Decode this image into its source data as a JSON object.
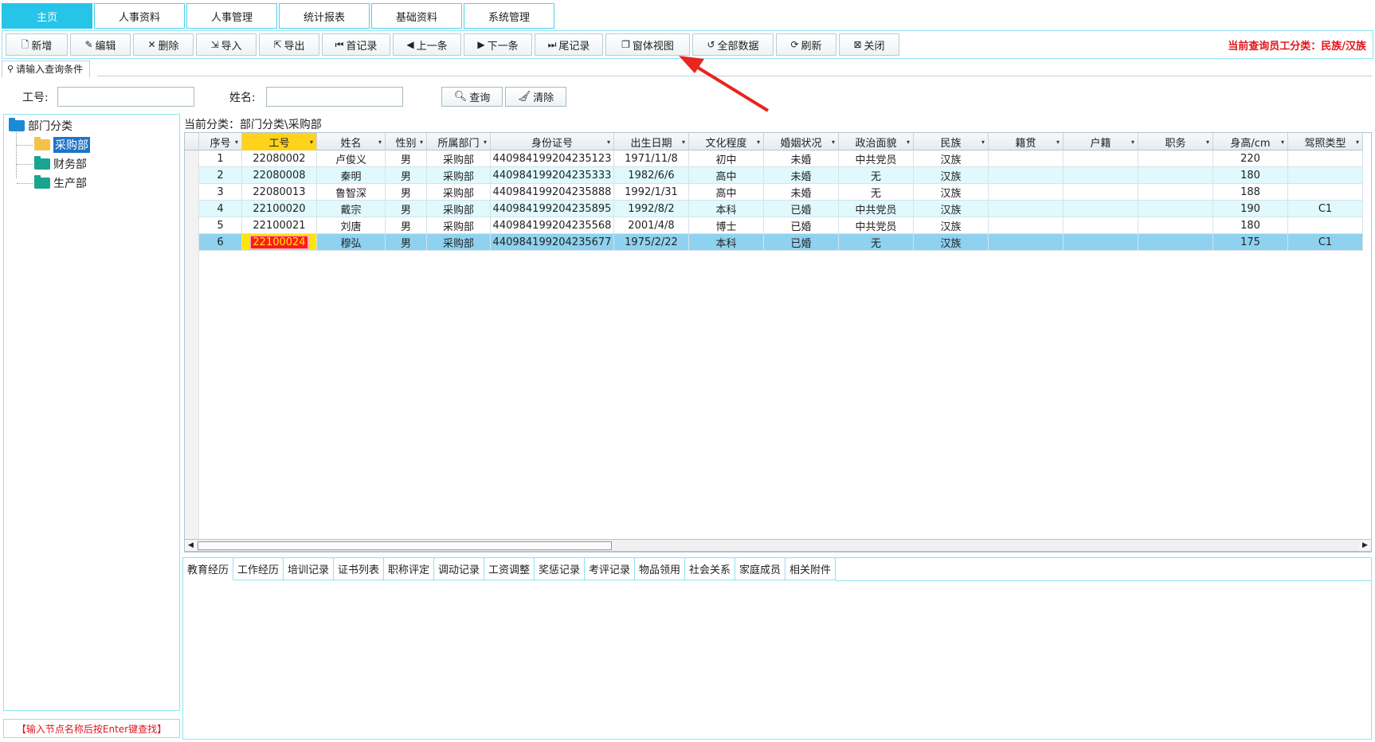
{
  "top_tabs": [
    "主页",
    "人事资料",
    "人事管理",
    "统计报表",
    "基础资料",
    "系统管理"
  ],
  "toolbar": {
    "buttons": [
      {
        "label": "新增",
        "icon": "new-doc-icon",
        "glyph": "🗋"
      },
      {
        "label": "编辑",
        "icon": "edit-icon",
        "glyph": "✎"
      },
      {
        "label": "删除",
        "icon": "delete-icon",
        "glyph": "✕"
      },
      {
        "label": "导入",
        "icon": "import-icon",
        "glyph": "⇲"
      },
      {
        "label": "导出",
        "icon": "export-icon",
        "glyph": "⇱"
      },
      {
        "label": "首记录",
        "icon": "first-record-icon",
        "glyph": "⏮"
      },
      {
        "label": "上一条",
        "icon": "prev-record-icon",
        "glyph": "◀"
      },
      {
        "label": "下一条",
        "icon": "next-record-icon",
        "glyph": "▶"
      },
      {
        "label": "尾记录",
        "icon": "last-record-icon",
        "glyph": "⏭"
      },
      {
        "label": "窗体视图",
        "icon": "form-view-icon",
        "glyph": "❐"
      },
      {
        "label": "全部数据",
        "icon": "all-data-icon",
        "glyph": "↺"
      },
      {
        "label": "刷新",
        "icon": "refresh-icon",
        "glyph": "⟳"
      },
      {
        "label": "关闭",
        "icon": "close-icon",
        "glyph": "⊠"
      }
    ],
    "status_text": "当前查询员工分类：民族/汉族"
  },
  "query": {
    "section_label": "请输入查询条件",
    "emp_id_label": "工号:",
    "emp_id_value": "",
    "name_label": "姓名:",
    "name_value": "",
    "search_btn": "查询",
    "clear_btn": "清除"
  },
  "tree": {
    "root": "部门分类",
    "children": [
      "采购部",
      "财务部",
      "生产部"
    ],
    "hint": "【输入节点名称后按Enter键查找】"
  },
  "grid": {
    "category_path": "当前分类：部门分类\\采购部",
    "columns": [
      "序号",
      "工号",
      "姓名",
      "性别",
      "所属部门",
      "身份证号",
      "出生日期",
      "文化程度",
      "婚姻状况",
      "政治面貌",
      "民族",
      "籍贯",
      "户籍",
      "职务",
      "身高/cm",
      "驾照类型"
    ],
    "rows": [
      [
        "1",
        "22080002",
        "卢俊义",
        "男",
        "采购部",
        "440984199204235123",
        "1971/11/8",
        "初中",
        "未婚",
        "中共党员",
        "汉族",
        "",
        "",
        "",
        "220",
        ""
      ],
      [
        "2",
        "22080008",
        "秦明",
        "男",
        "采购部",
        "440984199204235333",
        "1982/6/6",
        "高中",
        "未婚",
        "无",
        "汉族",
        "",
        "",
        "",
        "180",
        ""
      ],
      [
        "3",
        "22080013",
        "鲁智深",
        "男",
        "采购部",
        "440984199204235888",
        "1992/1/31",
        "高中",
        "未婚",
        "无",
        "汉族",
        "",
        "",
        "",
        "188",
        ""
      ],
      [
        "4",
        "22100020",
        "戴宗",
        "男",
        "采购部",
        "440984199204235895",
        "1992/8/2",
        "本科",
        "已婚",
        "中共党员",
        "汉族",
        "",
        "",
        "",
        "190",
        "C1"
      ],
      [
        "5",
        "22100021",
        "刘唐",
        "男",
        "采购部",
        "440984199204235568",
        "2001/4/8",
        "博士",
        "已婚",
        "中共党员",
        "汉族",
        "",
        "",
        "",
        "180",
        ""
      ],
      [
        "6",
        "22100024",
        "穆弘",
        "男",
        "采购部",
        "440984199204235677",
        "1975/2/22",
        "本科",
        "已婚",
        "无",
        "汉族",
        "",
        "",
        "",
        "175",
        "C1"
      ]
    ]
  },
  "bottom_tabs": [
    "教育经历",
    "工作经历",
    "培训记录",
    "证书列表",
    "职称评定",
    "调动记录",
    "工资调整",
    "奖惩记录",
    "考评记录",
    "物品领用",
    "社会关系",
    "家庭成员",
    "相关附件"
  ],
  "colors": {
    "accent": "#26c4e8",
    "status_red": "#e0161c",
    "row_alt": "#dff9fd",
    "row_selected": "#8fd2ef",
    "annotation_arrow": "#e8251f"
  }
}
